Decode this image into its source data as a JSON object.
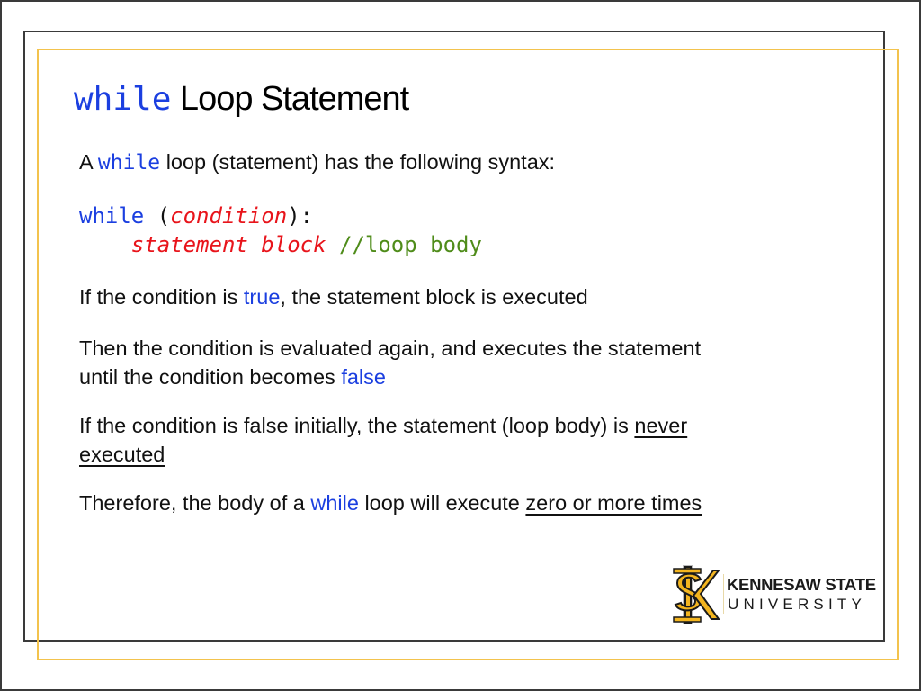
{
  "slide": {
    "title": {
      "keyword": "while",
      "rest": " Loop Statement"
    },
    "intro": {
      "prefix": "A ",
      "keyword": "while",
      "suffix": " loop (statement) has the following syntax:"
    },
    "code": {
      "line1": {
        "keyword": "while",
        "open": " (",
        "condition": "condition",
        "close": "):"
      },
      "line2": {
        "indent": "    ",
        "statement": "statement block",
        "comment": " //loop body"
      }
    },
    "p1": {
      "prefix": "If the condition is ",
      "highlight": "true",
      "suffix": ", the statement block is executed"
    },
    "p2": {
      "line1": "Then the condition is evaluated again, and executes the statement",
      "line2_prefix": "until the condition becomes ",
      "highlight": "false"
    },
    "p3": {
      "line1_prefix": " If the condition is false initially, the statement (loop body) is ",
      "underline1": "never",
      "underline2": "executed"
    },
    "p4": {
      "prefix": " Therefore, the body of a ",
      "highlight": "while",
      "middle": " loop will execute ",
      "underline": "zero or more times"
    },
    "logo": {
      "line1": "KENNESAW STATE",
      "line2": "UNIVERSITY",
      "icon": "ksu-monogram-icon"
    }
  },
  "colors": {
    "keyword": "#1b3fe0",
    "placeholder": "#e8141b",
    "comment": "#4f8c1a",
    "gold": "#f3c34d",
    "frame": "#3a3a3a"
  }
}
